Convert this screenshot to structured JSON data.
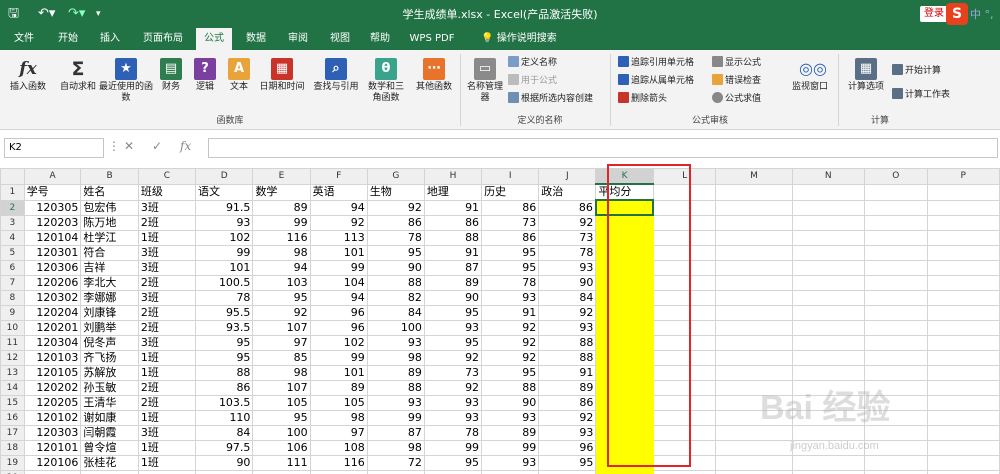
{
  "titlebar": {
    "title": "学生成绩单.xlsx - Excel(产品激活失败)",
    "login": "登录",
    "sogou": "S",
    "sogou_extra": "中 °,"
  },
  "menu": [
    "文件",
    "开始",
    "插入",
    "页面布局",
    "公式",
    "数据",
    "审阅",
    "视图",
    "帮助",
    "WPS PDF",
    "操作说明搜索"
  ],
  "ribbon": {
    "insert_fn": "插入函数",
    "autosum": "自动求和",
    "recent": "最近使用的函数",
    "finance": "财务",
    "logic": "逻辑",
    "text": "文本",
    "datetime": "日期和时间",
    "lookup": "查找与引用",
    "math": "数学和三角函数",
    "other": "其他函数",
    "name_mgr": "名称管理器",
    "define_name": "定义名称",
    "use_formula": "用于公式",
    "create_sel": "根据所选内容创建",
    "trace_prec": "追踪引用单元格",
    "trace_dep": "追踪从属单元格",
    "remove_arrows": "删除箭头",
    "show_formula": "显示公式",
    "error_check": "错误检查",
    "eval_formula": "公式求值",
    "watch": "监视窗口",
    "calc_opts": "计算选项",
    "calc_now": "开始计算",
    "calc_sheet": "计算工作表",
    "grp_fnlib": "函数库",
    "grp_names": "定义的名称",
    "grp_audit": "公式审核",
    "grp_calc": "计算"
  },
  "namebox": "K2",
  "columns": [
    "A",
    "B",
    "C",
    "D",
    "E",
    "F",
    "G",
    "H",
    "I",
    "J",
    "K",
    "L",
    "M",
    "N",
    "O",
    "P"
  ],
  "header_row": [
    "学号",
    "姓名",
    "班级",
    "语文",
    "数学",
    "英语",
    "生物",
    "地理",
    "历史",
    "政治",
    "平均分"
  ],
  "rows": [
    [
      "120305",
      "包宏伟",
      "3班",
      "91.5",
      "89",
      "94",
      "92",
      "91",
      "86",
      "86"
    ],
    [
      "120203",
      "陈万地",
      "2班",
      "93",
      "99",
      "92",
      "86",
      "86",
      "73",
      "92"
    ],
    [
      "120104",
      "杜学江",
      "1班",
      "102",
      "116",
      "113",
      "78",
      "88",
      "86",
      "73"
    ],
    [
      "120301",
      "符合",
      "3班",
      "99",
      "98",
      "101",
      "95",
      "91",
      "95",
      "78"
    ],
    [
      "120306",
      "吉祥",
      "3班",
      "101",
      "94",
      "99",
      "90",
      "87",
      "95",
      "93"
    ],
    [
      "120206",
      "李北大",
      "2班",
      "100.5",
      "103",
      "104",
      "88",
      "89",
      "78",
      "90"
    ],
    [
      "120302",
      "李娜娜",
      "3班",
      "78",
      "95",
      "94",
      "82",
      "90",
      "93",
      "84"
    ],
    [
      "120204",
      "刘康锋",
      "2班",
      "95.5",
      "92",
      "96",
      "84",
      "95",
      "91",
      "92"
    ],
    [
      "120201",
      "刘鹏举",
      "2班",
      "93.5",
      "107",
      "96",
      "100",
      "93",
      "92",
      "93"
    ],
    [
      "120304",
      "倪冬声",
      "3班",
      "95",
      "97",
      "102",
      "93",
      "95",
      "92",
      "88"
    ],
    [
      "120103",
      "齐飞扬",
      "1班",
      "95",
      "85",
      "99",
      "98",
      "92",
      "92",
      "88"
    ],
    [
      "120105",
      "苏解放",
      "1班",
      "88",
      "98",
      "101",
      "89",
      "73",
      "95",
      "91"
    ],
    [
      "120202",
      "孙玉敏",
      "2班",
      "86",
      "107",
      "89",
      "88",
      "92",
      "88",
      "89"
    ],
    [
      "120205",
      "王清华",
      "2班",
      "103.5",
      "105",
      "105",
      "93",
      "93",
      "90",
      "86"
    ],
    [
      "120102",
      "谢如康",
      "1班",
      "110",
      "95",
      "98",
      "99",
      "93",
      "93",
      "92"
    ],
    [
      "120303",
      "闫朝霞",
      "3班",
      "84",
      "100",
      "97",
      "87",
      "78",
      "89",
      "93"
    ],
    [
      "120101",
      "曾令煊",
      "1班",
      "97.5",
      "106",
      "108",
      "98",
      "99",
      "99",
      "96"
    ],
    [
      "120106",
      "张桂花",
      "1班",
      "90",
      "111",
      "116",
      "72",
      "95",
      "93",
      "95"
    ]
  ],
  "watermark": "Bai 经验",
  "watermark_sub": "jingyan.baidu.com"
}
